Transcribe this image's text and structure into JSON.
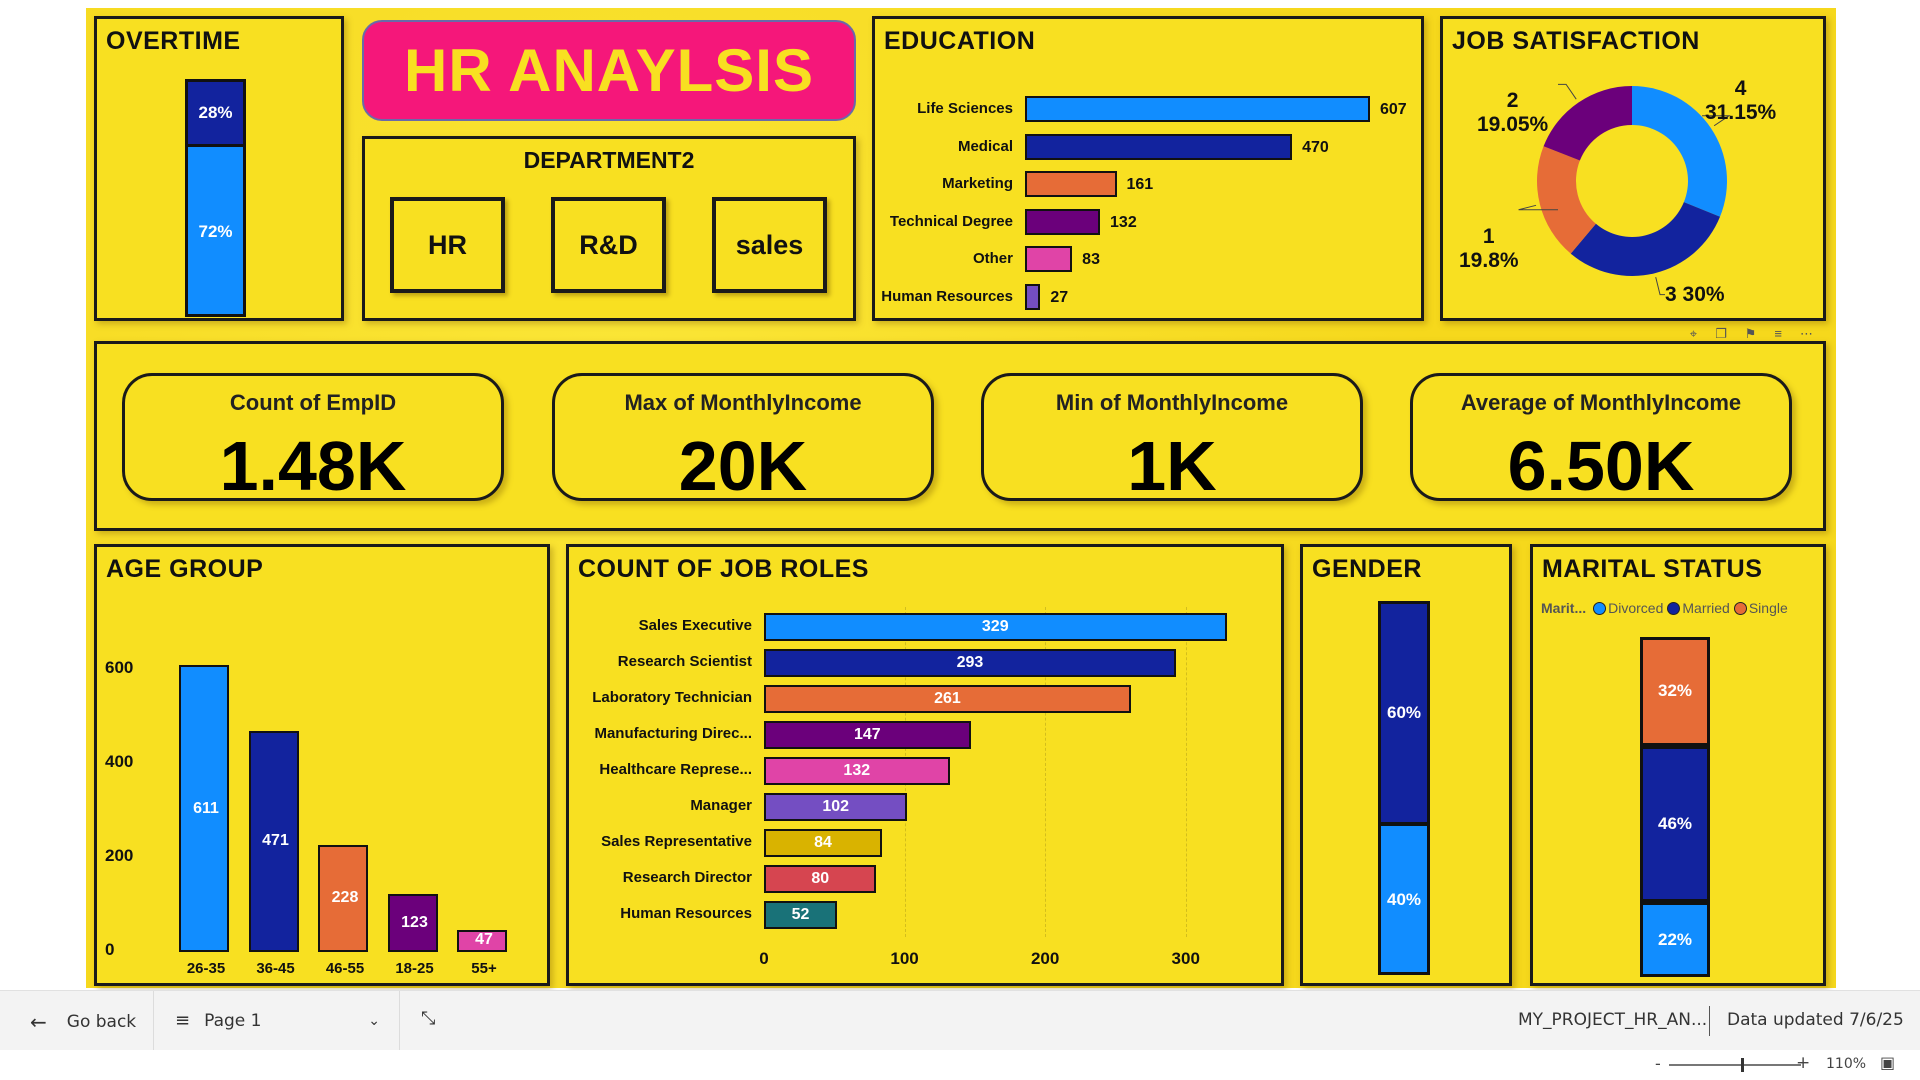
{
  "overtime": {
    "title": "OVERTIME",
    "yes_pct": "28%",
    "no_pct": "72%",
    "yes_share": 0.28,
    "no_share": 0.72
  },
  "header": {
    "title": "HR ANAYLSIS"
  },
  "department": {
    "title": "DEPARTMENT2",
    "buttons": [
      "HR",
      "R&D",
      "sales"
    ]
  },
  "education": {
    "title": "EDUCATION",
    "chart_data": {
      "type": "bar",
      "orientation": "horizontal",
      "categories": [
        "Life Sciences",
        "Medical",
        "Marketing",
        "Technical Degree",
        "Other",
        "Human Resources"
      ],
      "values": [
        607,
        470,
        161,
        132,
        83,
        27
      ],
      "colors": [
        "#118dff",
        "#12239e",
        "#e66c37",
        "#6b007b",
        "#e044a7",
        "#744ec2"
      ]
    }
  },
  "job_satisfaction": {
    "title": "JOB SATISFACTION",
    "chart_data": {
      "type": "pie",
      "donut": true,
      "slices": [
        {
          "label": "4",
          "pct_text": "31.15%",
          "value": 31.15,
          "color": "#118dff"
        },
        {
          "label": "3",
          "pct_text": "30%",
          "value": 30.0,
          "color": "#12239e"
        },
        {
          "label": "1",
          "pct_text": "19.8%",
          "value": 19.8,
          "color": "#e66c37"
        },
        {
          "label": "2",
          "pct_text": "19.05%",
          "value": 19.05,
          "color": "#6b007b"
        }
      ]
    }
  },
  "kpis": [
    {
      "label": "Count of EmpID",
      "value": "1.48K"
    },
    {
      "label": "Max of MonthlyIncome",
      "value": "20K"
    },
    {
      "label": "Min of MonthlyIncome",
      "value": "1K"
    },
    {
      "label": "Average of MonthlyIncome",
      "value": "6.50K"
    }
  ],
  "age_group": {
    "title": "AGE GROUP",
    "chart_data": {
      "type": "bar",
      "categories": [
        "26-35",
        "36-45",
        "46-55",
        "18-25",
        "55+"
      ],
      "values": [
        611,
        471,
        228,
        123,
        47
      ],
      "colors": [
        "#118dff",
        "#12239e",
        "#e66c37",
        "#6b007b",
        "#e044a7"
      ],
      "ylim": [
        0,
        660
      ],
      "yticks": [
        0,
        200,
        400,
        600
      ]
    }
  },
  "job_roles": {
    "title": "COUNT OF JOB ROLES",
    "chart_data": {
      "type": "bar",
      "orientation": "horizontal",
      "categories": [
        "Sales Executive",
        "Research Scientist",
        "Laboratory Technician",
        "Manufacturing Direc...",
        "Healthcare Represe...",
        "Manager",
        "Sales Representative",
        "Research Director",
        "Human Resources"
      ],
      "values": [
        329,
        293,
        261,
        147,
        132,
        102,
        84,
        80,
        52
      ],
      "colors": [
        "#118dff",
        "#12239e",
        "#e66c37",
        "#6b007b",
        "#e044a7",
        "#744ec2",
        "#d9b300",
        "#d64550",
        "#197278"
      ],
      "xlim": [
        0,
        345
      ],
      "xticks": [
        0,
        100,
        200,
        300
      ]
    }
  },
  "gender": {
    "title": "GENDER",
    "top_pct": "60%",
    "bottom_pct": "40%",
    "top_share": 0.6,
    "bottom_share": 0.4
  },
  "marital": {
    "title": "MARITAL STATUS",
    "legend_title": "Marit...",
    "legend": [
      {
        "name": "Divorced",
        "color": "#118dff"
      },
      {
        "name": "Married",
        "color": "#12239e"
      },
      {
        "name": "Single",
        "color": "#e66c37"
      }
    ],
    "chart_data": {
      "type": "bar",
      "stacked": true,
      "segments": [
        {
          "name": "Single",
          "pct_text": "32%",
          "value": 32,
          "color": "#e66c37"
        },
        {
          "name": "Married",
          "pct_text": "46%",
          "value": 46,
          "color": "#12239e"
        },
        {
          "name": "Divorced",
          "pct_text": "22%",
          "value": 22,
          "color": "#118dff"
        }
      ]
    }
  },
  "footer": {
    "go_back": "Go back",
    "page": "Page 1",
    "report_name": "MY_PROJECT_HR_AN...",
    "data_updated": "Data updated 7/6/25",
    "zoom": "110%",
    "zoom_level": 0.55
  }
}
